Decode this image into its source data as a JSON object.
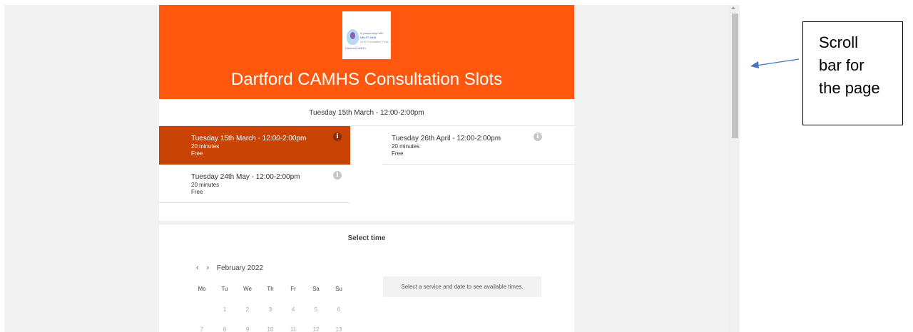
{
  "page": {
    "site_title": "Dartford CAMHS Consultation Slots",
    "logo": {
      "line1": "in partnership with",
      "line2": "NELFT NHS",
      "line3": "NHS Foundation Trust",
      "line4": "DartfordCAMHS"
    },
    "selected_service_heading": "Tuesday 15th March - 12:00-2:00pm",
    "services": [
      {
        "name": "Tuesday 15th March - 12:00-2:00pm",
        "duration": "20 minutes",
        "price": "Free",
        "info": "i",
        "selected": true
      },
      {
        "name": "Tuesday 26th April - 12:00-2:00pm",
        "duration": "20 minutes",
        "price": "Free",
        "info": "i",
        "selected": false
      },
      {
        "name": "Tuesday 24th May - 12:00-2:00pm",
        "duration": "20 minutes",
        "price": "Free",
        "info": "i",
        "selected": false
      }
    ],
    "select_time_title": "Select time",
    "calendar": {
      "prev": "‹",
      "next": "›",
      "month": "February 2022",
      "weekdays": [
        "Mo",
        "Tu",
        "We",
        "Th",
        "Fr",
        "Sa",
        "Su"
      ],
      "week1": [
        "1",
        "2",
        "3",
        "4",
        "5",
        "6"
      ],
      "week2": [
        "7",
        "8",
        "9",
        "10",
        "11",
        "12",
        "13"
      ]
    },
    "times_placeholder": "Select a service and date to see available times."
  },
  "annotation": {
    "text": "Scroll\nbar for\nthe page"
  },
  "colors": {
    "brand_orange": "#ff570d",
    "selected_service": "#c94305",
    "annotation_arrow": "#4472c4"
  }
}
